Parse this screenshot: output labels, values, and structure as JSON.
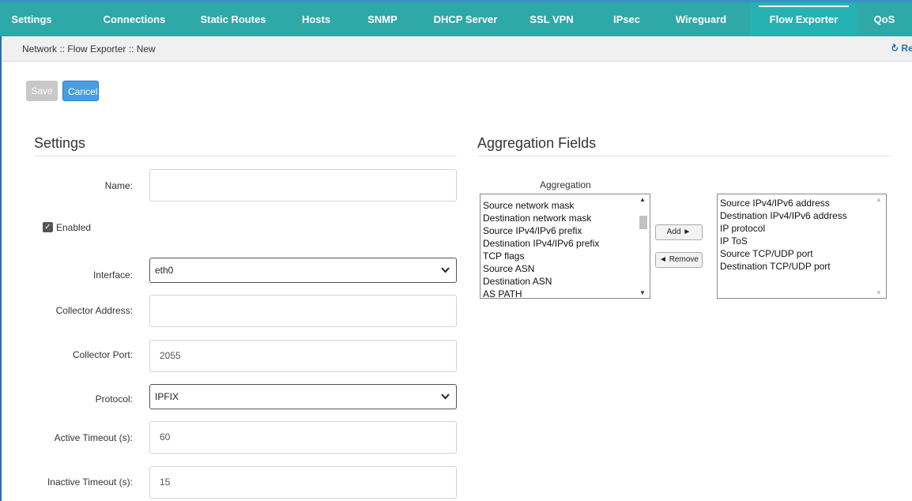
{
  "tabs": [
    {
      "label": "Settings"
    },
    {
      "label": "Connections"
    },
    {
      "label": "Static Routes"
    },
    {
      "label": "Hosts"
    },
    {
      "label": "SNMP"
    },
    {
      "label": "DHCP Server"
    },
    {
      "label": "SSL VPN"
    },
    {
      "label": "IPsec"
    },
    {
      "label": "Wireguard"
    },
    {
      "label": "Flow Exporter",
      "active": true
    },
    {
      "label": "QoS"
    }
  ],
  "breadcrumb": "Network :: Flow Exporter :: New",
  "refresh_label": "Re",
  "refresh_icon": "refresh-icon",
  "buttons": {
    "save": "Save",
    "cancel": "Cancel"
  },
  "settings": {
    "title": "Settings",
    "name": {
      "label": "Name:",
      "value": ""
    },
    "enabled": {
      "label": "Enabled",
      "checked": true
    },
    "interface": {
      "label": "Interface:",
      "value": "eth0"
    },
    "collector_address": {
      "label": "Collector Address:",
      "value": ""
    },
    "collector_port": {
      "label": "Collector Port:",
      "value": "2055"
    },
    "protocol": {
      "label": "Protocol:",
      "value": "IPFIX"
    },
    "active_timeout": {
      "label": "Active Timeout (s):",
      "value": "60"
    },
    "inactive_timeout": {
      "label": "Inactive Timeout (s):",
      "value": "15"
    }
  },
  "aggregation": {
    "title": "Aggregation Fields",
    "caption": "Aggregation",
    "available": [
      "Source network mask",
      "Destination network mask",
      "Source IPv4/IPv6 prefix",
      "Destination IPv4/IPv6 prefix",
      "TCP flags",
      "Source ASN",
      "Destination ASN",
      "AS PATH"
    ],
    "selected": [
      "Source IPv4/IPv6 address",
      "Destination IPv4/IPv6 address",
      "IP protocol",
      "IP ToS",
      "Source TCP/UDP port",
      "Destination TCP/UDP port"
    ],
    "add_label": "Add ►",
    "remove_label": "◄ Remove"
  },
  "colors": {
    "topbar": "#2fa8a8",
    "accent": "#4a9de0",
    "left_border": "#2a6db5"
  }
}
